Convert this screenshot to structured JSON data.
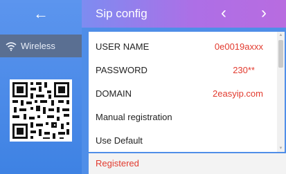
{
  "sidebar": {
    "back_icon": "arrow-left-icon",
    "back_glyph": "←",
    "items": [
      {
        "label": "Wireless",
        "icon": "wifi-icon"
      }
    ],
    "qr_icon": "qr-code-icon"
  },
  "header": {
    "title": "Sip config",
    "prev_glyph": "‹",
    "next_glyph": "›"
  },
  "fields": [
    {
      "label": "USER NAME",
      "value": "0e0019axxx"
    },
    {
      "label": "PASSWORD",
      "value": "230**"
    },
    {
      "label": "DOMAIN",
      "value": "2easyip.com"
    },
    {
      "label": "Manual registration",
      "value": ""
    },
    {
      "label": "Use Default",
      "value": ""
    }
  ],
  "scroll": {
    "up_glyph": "▲",
    "down_glyph": "▼"
  },
  "status": {
    "text": "Registered"
  },
  "colors": {
    "accent": "#e23a2e",
    "header_start": "#7d8cf1",
    "header_end": "#b86ce0",
    "sidebar": "#4f8ee8"
  }
}
